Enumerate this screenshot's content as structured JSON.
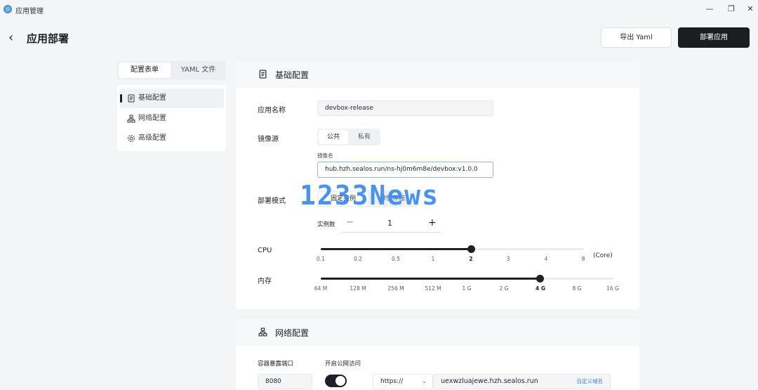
{
  "window": {
    "title": "应用管理",
    "minimize": "—",
    "restore": "❐",
    "close": "✕"
  },
  "header": {
    "back": "‹",
    "title": "应用部署",
    "export_label": "导出 Yaml",
    "deploy_label": "部署应用"
  },
  "tabs": {
    "form": "配置表单",
    "yaml": "YAML 文件"
  },
  "nav": {
    "items": [
      {
        "label": "基础配置",
        "icon": "document-icon"
      },
      {
        "label": "网络配置",
        "icon": "network-icon"
      },
      {
        "label": "高级配置",
        "icon": "gear-icon"
      }
    ]
  },
  "basic": {
    "title": "基础配置",
    "app_name_label": "应用名称",
    "app_name_value": "devbox-release",
    "image_source_label": "镜像源",
    "image_source_options": [
      "公共",
      "私有"
    ],
    "image_name_label": "镜像名",
    "image_name_value": "hub.hzh.sealos.run/ns-hj0m6m8e/devbox:v1.0.0",
    "deploy_mode_label": "部署模式",
    "deploy_mode_options": [
      "固定实例",
      "弹性伸缩"
    ],
    "instances_label": "实例数",
    "instances_value": "1",
    "minus": "−",
    "plus": "+",
    "cpu_label": "CPU",
    "cpu_unit": "(Core)",
    "cpu_ticks": [
      "0.1",
      "0.2",
      "0.5",
      "1",
      "2",
      "3",
      "4",
      "8"
    ],
    "cpu_selected_index": 4,
    "memory_label": "内存",
    "memory_ticks": [
      "64 M",
      "128 M",
      "256 M",
      "512 M",
      "1 G",
      "2 G",
      "4 G",
      "8 G",
      "16 G"
    ],
    "memory_selected_index": 6
  },
  "network": {
    "title": "网络配置",
    "port_label": "容器暴露端口",
    "port_value": "8080",
    "public_label": "开启公网访问",
    "public_enabled": true,
    "protocol_value": "https://",
    "domain_value": "uexwzluajewe.hzh.sealos.run",
    "custom_domain_label": "自定义域名"
  },
  "watermark": "1233News",
  "colors": {
    "primary": "#1d2026",
    "link": "#3f7fe0",
    "watermark": "#3f8df0"
  }
}
